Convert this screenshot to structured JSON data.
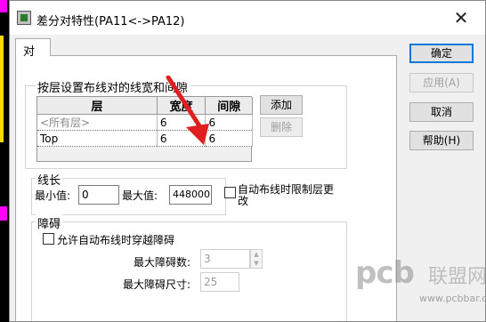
{
  "window": {
    "title": "差分对特性(PA11<->PA12)"
  },
  "tabs": [
    {
      "label": "对"
    }
  ],
  "layer_group": {
    "legend": "按层设置布线对的线宽和间隙",
    "columns": [
      "层",
      "宽度",
      "间隙"
    ],
    "rows": [
      {
        "layer": "<所有层>",
        "width": "6",
        "gap": "6"
      },
      {
        "layer": "Top",
        "width": "6",
        "gap": "6"
      }
    ],
    "add_label": "添加",
    "delete_label": "删除"
  },
  "length_group": {
    "legend": "线长",
    "min_label": "最小值:",
    "min_value": "0",
    "max_label": "最大值:",
    "max_value": "448000"
  },
  "auto_route_restrict_layer_label": "自动布线时限制层更改",
  "obstacle_group": {
    "legend": "障碍",
    "allow_cross_label": "允许自动布线时穿越障碍",
    "max_count_label": "最大障碍数:",
    "max_count_value": "3",
    "max_size_label": "最大障碍尺寸:",
    "max_size_value": "25"
  },
  "buttons": {
    "ok": "确定",
    "apply": "应用(A)",
    "cancel": "取消",
    "help": "帮助(H)"
  },
  "watermark": {
    "brand": "pcb",
    "brand_cn": "联盟网",
    "url": "www.pcbbar.com"
  },
  "colors": {
    "arrow": "#e02020",
    "accent": "#0078d7"
  }
}
